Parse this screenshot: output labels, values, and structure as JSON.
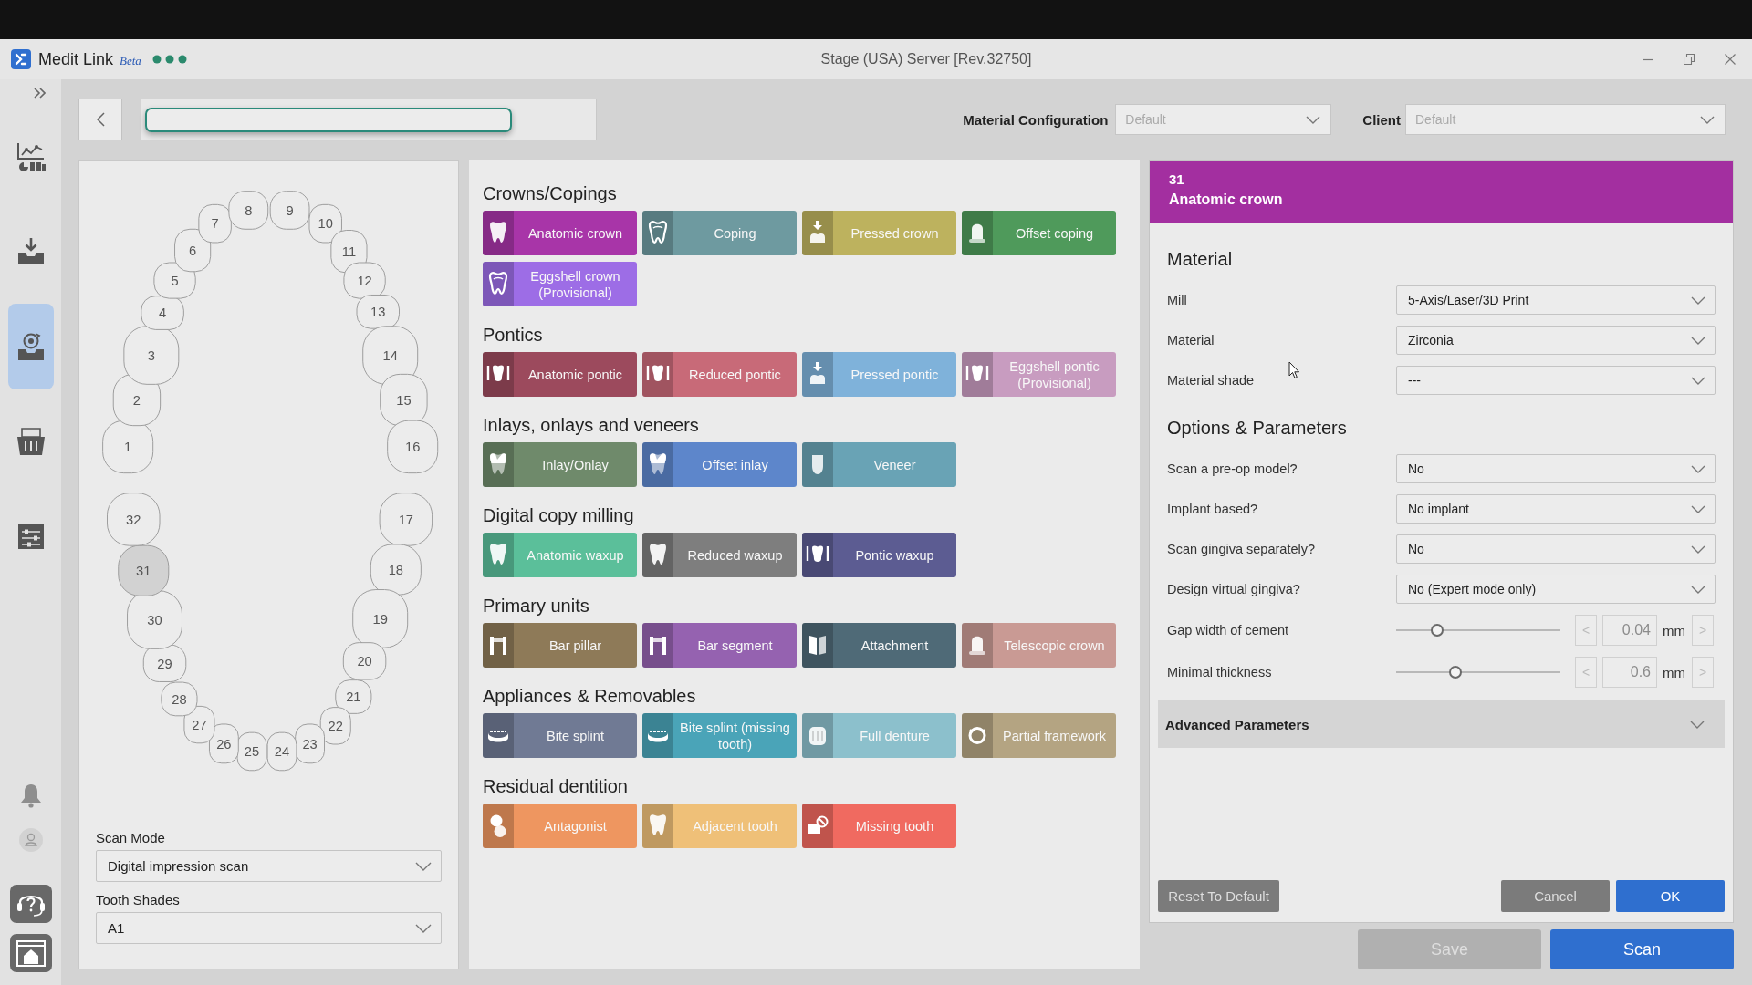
{
  "window": {
    "app_name": "Medit Link",
    "app_badge": "Beta",
    "title": "Stage (USA) Server [Rev.32750]"
  },
  "sidebar": {
    "items": [
      {
        "selected": false
      },
      {
        "selected": false
      },
      {
        "selected": true
      },
      {
        "selected": false
      },
      {
        "selected": false
      }
    ]
  },
  "toolbar": {
    "search": {
      "focused": true
    },
    "material_configuration": {
      "label": "Material Configuration",
      "placeholder": "Default"
    },
    "client": {
      "label": "Client",
      "placeholder": "Default"
    }
  },
  "tooth_chart": {
    "teeth": [
      {
        "number": "1",
        "selected": false
      },
      {
        "number": "2",
        "selected": false
      },
      {
        "number": "3",
        "selected": false
      },
      {
        "number": "4",
        "selected": false
      },
      {
        "number": "5",
        "selected": false
      },
      {
        "number": "6",
        "selected": false
      },
      {
        "number": "7",
        "selected": false
      },
      {
        "number": "8",
        "selected": false
      },
      {
        "number": "9",
        "selected": false
      },
      {
        "number": "10",
        "selected": false
      },
      {
        "number": "11",
        "selected": false
      },
      {
        "number": "12",
        "selected": false
      },
      {
        "number": "13",
        "selected": false
      },
      {
        "number": "14",
        "selected": false
      },
      {
        "number": "15",
        "selected": false
      },
      {
        "number": "16",
        "selected": false
      },
      {
        "number": "17",
        "selected": false
      },
      {
        "number": "18",
        "selected": false
      },
      {
        "number": "19",
        "selected": false
      },
      {
        "number": "20",
        "selected": false
      },
      {
        "number": "21",
        "selected": false
      },
      {
        "number": "22",
        "selected": false
      },
      {
        "number": "23",
        "selected": false
      },
      {
        "number": "24",
        "selected": false
      },
      {
        "number": "25",
        "selected": false
      },
      {
        "number": "26",
        "selected": false
      },
      {
        "number": "27",
        "selected": false
      },
      {
        "number": "28",
        "selected": false
      },
      {
        "number": "29",
        "selected": false
      },
      {
        "number": "30",
        "selected": false
      },
      {
        "number": "31",
        "selected": true
      },
      {
        "number": "32",
        "selected": false
      }
    ]
  },
  "scan_mode": {
    "label": "Scan Mode",
    "value": "Digital impression scan"
  },
  "tooth_shades": {
    "label": "Tooth Shades",
    "value": "A1"
  },
  "sections": [
    {
      "title": "Crowns/Copings",
      "buttons": [
        {
          "label": "Anatomic crown",
          "color": "#a835a8"
        },
        {
          "label": "Coping",
          "color": "#6e9aa0"
        },
        {
          "label": "Pressed crown",
          "color": "#bdb25e"
        },
        {
          "label": "Offset coping",
          "color": "#4f9a5b"
        },
        {
          "label": "Eggshell crown (Provisional)",
          "color": "#9d6de6"
        }
      ]
    },
    {
      "title": "Pontics",
      "buttons": [
        {
          "label": "Anatomic pontic",
          "color": "#9c4a5d"
        },
        {
          "label": "Reduced pontic",
          "color": "#c86a78"
        },
        {
          "label": "Pressed pontic",
          "color": "#7fb2da"
        },
        {
          "label": "Eggshell pontic (Provisional)",
          "color": "#c89cc0"
        }
      ]
    },
    {
      "title": "Inlays, onlays and veneers",
      "buttons": [
        {
          "label": "Inlay/Onlay",
          "color": "#6f8a6b"
        },
        {
          "label": "Offset inlay",
          "color": "#5d86cb"
        },
        {
          "label": "Veneer",
          "color": "#69a3b5"
        }
      ]
    },
    {
      "title": "Digital copy milling",
      "buttons": [
        {
          "label": "Anatomic waxup",
          "color": "#5bbf9a"
        },
        {
          "label": "Reduced waxup",
          "color": "#7e7e7e"
        },
        {
          "label": "Pontic waxup",
          "color": "#5c5c92"
        }
      ]
    },
    {
      "title": "Primary units",
      "buttons": [
        {
          "label": "Bar pillar",
          "color": "#8e7a58"
        },
        {
          "label": "Bar segment",
          "color": "#9562b0"
        },
        {
          "label": "Attachment",
          "color": "#4f6a77"
        },
        {
          "label": "Telescopic crown",
          "color": "#c99a94"
        }
      ]
    },
    {
      "title": "Appliances & Removables",
      "buttons": [
        {
          "label": "Bite splint",
          "color": "#707a94"
        },
        {
          "label": "Bite splint (missing tooth)",
          "color": "#4aa4b8"
        },
        {
          "label": "Full denture",
          "color": "#8cc0cc"
        },
        {
          "label": "Partial framework",
          "color": "#b4a482"
        }
      ]
    },
    {
      "title": "Residual dentition",
      "buttons": [
        {
          "label": "Antagonist",
          "color": "#ee9660"
        },
        {
          "label": "Adjacent tooth",
          "color": "#efc078"
        },
        {
          "label": "Missing tooth",
          "color": "#f06a60"
        }
      ]
    }
  ],
  "details": {
    "tooth": "31",
    "title": "Anatomic crown",
    "material_heading": "Material",
    "material_fields": [
      {
        "label": "Mill",
        "value": "5-Axis/Laser/3D Print"
      },
      {
        "label": "Material",
        "value": "Zirconia"
      },
      {
        "label": "Material shade",
        "value": "---"
      }
    ],
    "options_heading": "Options & Parameters",
    "option_fields": [
      {
        "kind": "dropdown",
        "label": "Scan a pre-op model?",
        "value": "No"
      },
      {
        "kind": "dropdown",
        "label": "Implant based?",
        "value": "No implant"
      },
      {
        "kind": "dropdown",
        "label": "Scan gingiva separately?",
        "value": "No"
      },
      {
        "kind": "dropdown",
        "label": "Design virtual gingiva?",
        "value": "No (Expert mode only)"
      },
      {
        "kind": "slider",
        "label": "Gap width of cement",
        "level": 0.23,
        "decrement": "<",
        "value": "0.04",
        "unit": "mm",
        "increment": ">",
        "disabled": true
      },
      {
        "kind": "slider",
        "label": "Minimal thickness",
        "level": 0.35,
        "decrement": "<",
        "value": "0.6",
        "unit": "mm",
        "increment": ">",
        "disabled": true
      }
    ],
    "advanced": {
      "label": "Advanced Parameters",
      "expanded": false
    },
    "reset_label": "Reset To Default",
    "buttons": [
      {
        "label": "Cancel",
        "kind": "secondary"
      },
      {
        "label": "OK",
        "kind": "primary"
      }
    ]
  },
  "actions": [
    {
      "label": "Save",
      "disabled": true
    },
    {
      "label": "Scan",
      "disabled": false
    }
  ]
}
